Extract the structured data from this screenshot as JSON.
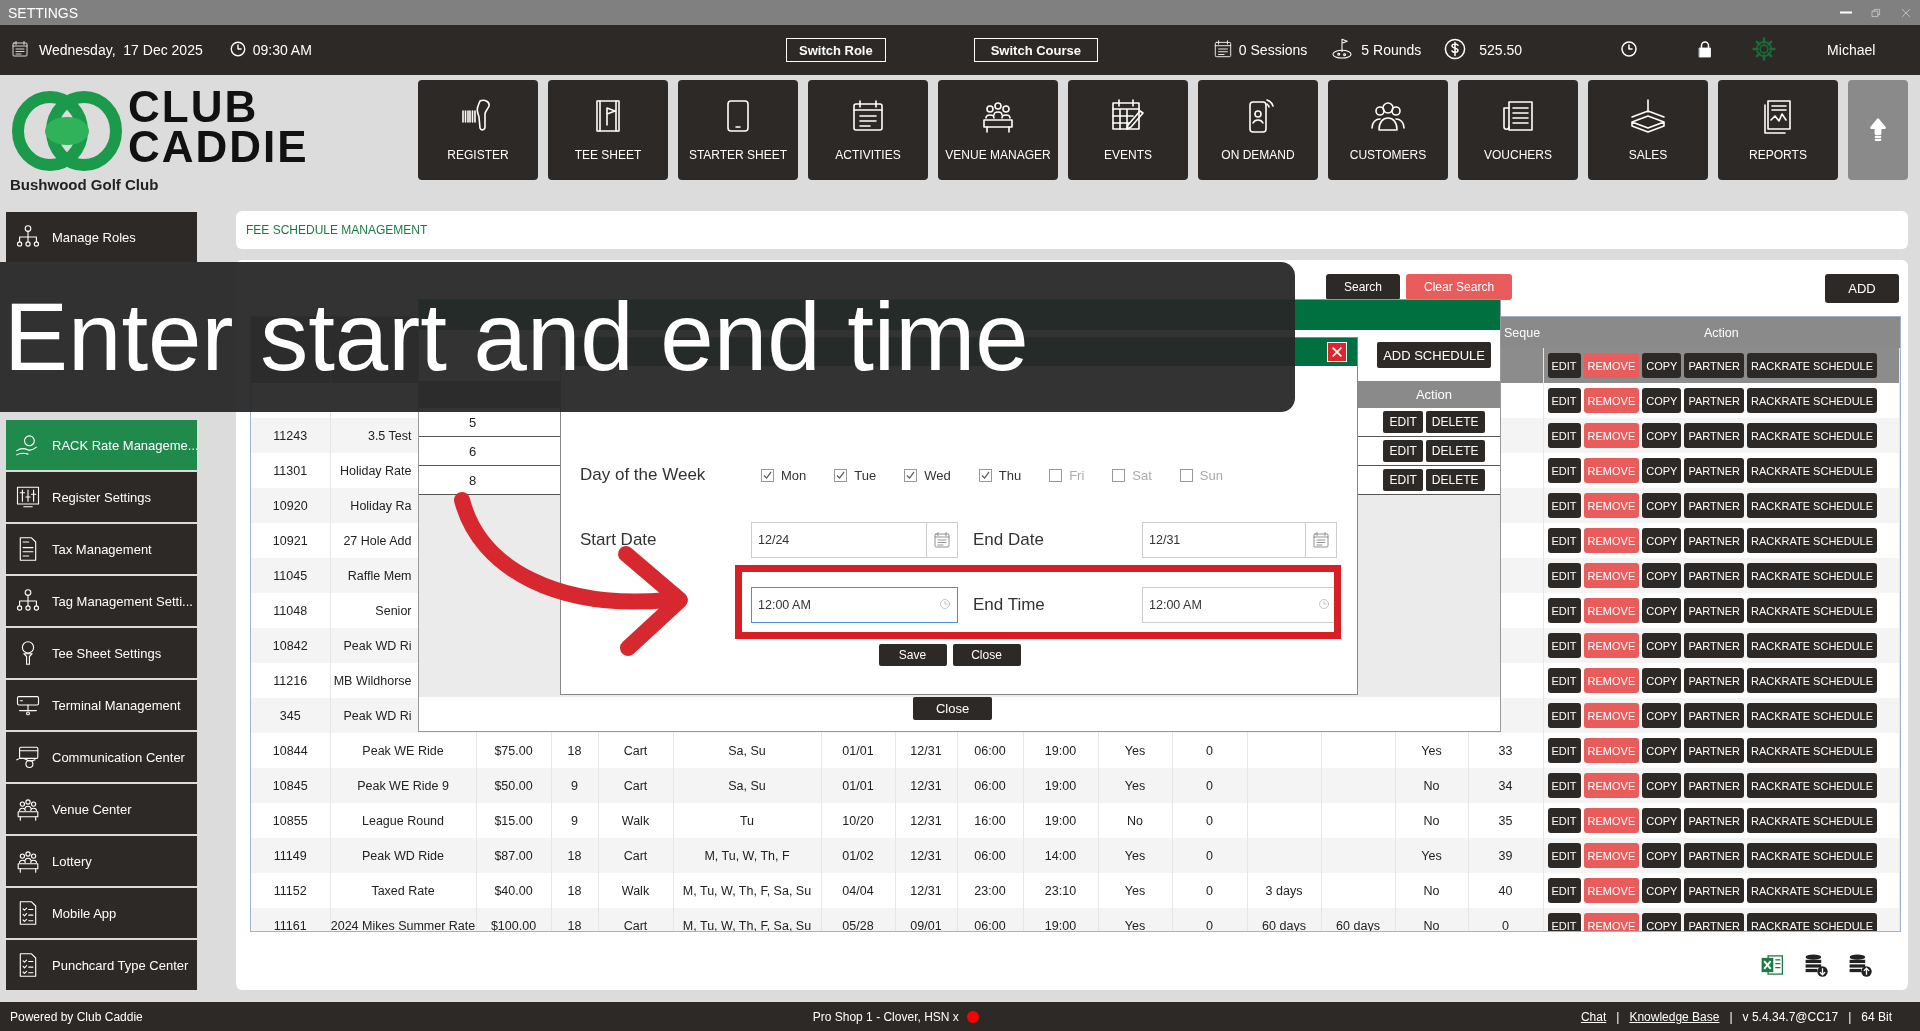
{
  "window": {
    "title": "SETTINGS"
  },
  "top_bar": {
    "date": "Wednesday,  17 Dec 2025",
    "time": "09:30 AM",
    "buttons": [
      "Switch Role",
      "Switch Course"
    ],
    "stats": [
      "0 Sessions",
      "5 Rounds",
      "525.50"
    ],
    "user": "Michael"
  },
  "brand": {
    "logo": [
      "CLUB",
      "CADDIE"
    ],
    "club": "Bushwood Golf Club"
  },
  "nav": [
    "REGISTER",
    "TEE SHEET",
    "STARTER SHEET",
    "ACTIVITIES",
    "VENUE MANAGER",
    "EVENTS",
    "ON DEMAND",
    "CUSTOMERS",
    "VOUCHERS",
    "SALES",
    "REPORTS"
  ],
  "sidebar": {
    "top_items": [
      {
        "label": "Manage Roles",
        "selected": false
      }
    ],
    "items": [
      {
        "label": "RACK Rate Manageme...",
        "selected": true
      },
      {
        "label": "Register Settings",
        "selected": false
      },
      {
        "label": "Tax Management",
        "selected": false
      },
      {
        "label": "Tag Management Setti...",
        "selected": false
      },
      {
        "label": "Tee Sheet Settings",
        "selected": false
      },
      {
        "label": "Terminal Management",
        "selected": false
      },
      {
        "label": "Communication Center",
        "selected": false
      },
      {
        "label": "Venue Center",
        "selected": false
      },
      {
        "label": "Lottery",
        "selected": false
      },
      {
        "label": "Mobile App",
        "selected": false
      },
      {
        "label": "Punchcard Type Center",
        "selected": false
      }
    ]
  },
  "page": {
    "title": "FEE SCHEDULE MANAGEMENT",
    "filter_buttons": [
      "Search",
      "Clear Search"
    ],
    "add_button": "ADD"
  },
  "table": {
    "header": {
      "column_16": "Seque",
      "action": "Action"
    },
    "rows": [
      {
        "selected": true,
        "actions": [
          "EDIT",
          "REMOVE",
          "COPY",
          "PARTNER",
          "RACKRATE SCHEDULE"
        ]
      },
      {
        "selected": false,
        "actions": [
          "EDIT",
          "REMOVE",
          "COPY",
          "PARTNER",
          "RACKRATE SCHEDULE"
        ]
      },
      {
        "selected": false,
        "cells": [
          "11243",
          "3.5 Test"
        ],
        "actions": [
          "EDIT",
          "REMOVE",
          "COPY",
          "PARTNER",
          "RACKRATE SCHEDULE"
        ]
      },
      {
        "selected": false,
        "cells": [
          "11301",
          "Holiday Rate"
        ],
        "actions": [
          "EDIT",
          "REMOVE",
          "COPY",
          "PARTNER",
          "RACKRATE SCHEDULE"
        ]
      },
      {
        "selected": false,
        "cells": [
          "10920",
          "Holiday Ra"
        ],
        "actions": [
          "EDIT",
          "REMOVE",
          "COPY",
          "PARTNER",
          "RACKRATE SCHEDULE"
        ]
      },
      {
        "selected": false,
        "cells": [
          "10921",
          "27 Hole Add"
        ],
        "actions": [
          "EDIT",
          "REMOVE",
          "COPY",
          "PARTNER",
          "RACKRATE SCHEDULE"
        ]
      },
      {
        "selected": false,
        "cells": [
          "11045",
          "Raffle Mem"
        ],
        "actions": [
          "EDIT",
          "REMOVE",
          "COPY",
          "PARTNER",
          "RACKRATE SCHEDULE"
        ]
      },
      {
        "selected": false,
        "cells": [
          "11048",
          "Senior"
        ],
        "actions": [
          "EDIT",
          "REMOVE",
          "COPY",
          "PARTNER",
          "RACKRATE SCHEDULE"
        ]
      },
      {
        "selected": false,
        "cells": [
          "10842",
          "Peak WD Ri"
        ],
        "actions": [
          "EDIT",
          "REMOVE",
          "COPY",
          "PARTNER",
          "RACKRATE SCHEDULE"
        ]
      },
      {
        "selected": false,
        "cells": [
          "11216",
          "MB Wildhorse"
        ],
        "actions": [
          "EDIT",
          "REMOVE",
          "COPY",
          "PARTNER",
          "RACKRATE SCHEDULE"
        ]
      },
      {
        "selected": false,
        "cells": [
          "345",
          "Peak WD Ri"
        ],
        "actions": [
          "EDIT",
          "REMOVE",
          "COPY",
          "PARTNER",
          "RACKRATE SCHEDULE"
        ]
      },
      {
        "selected": false,
        "cells": [
          "10844",
          "Peak WE Ride",
          "$75.00",
          "18",
          "Cart",
          "Sa, Su",
          "01/01",
          "12/31",
          "06:00",
          "19:00",
          "Yes",
          "0",
          null,
          null,
          "Yes",
          "33"
        ],
        "actions": [
          "EDIT",
          "REMOVE",
          "COPY",
          "PARTNER",
          "RACKRATE SCHEDULE"
        ]
      },
      {
        "selected": false,
        "cells": [
          "10845",
          "Peak WE Ride 9",
          "$50.00",
          "9",
          "Cart",
          "Sa, Su",
          "01/01",
          "12/31",
          "06:00",
          "19:00",
          "Yes",
          "0",
          null,
          null,
          "No",
          "34"
        ],
        "actions": [
          "EDIT",
          "REMOVE",
          "COPY",
          "PARTNER",
          "RACKRATE SCHEDULE"
        ]
      },
      {
        "selected": false,
        "cells": [
          "10855",
          "League Round",
          "$15.00",
          "9",
          "Walk",
          "Tu",
          "10/20",
          "12/31",
          "16:00",
          "19:00",
          "No",
          "0",
          null,
          null,
          "No",
          "35"
        ],
        "actions": [
          "EDIT",
          "REMOVE",
          "COPY",
          "PARTNER",
          "RACKRATE SCHEDULE"
        ]
      },
      {
        "selected": false,
        "cells": [
          "11149",
          "Peak WD Ride",
          "$87.00",
          "18",
          "Cart",
          "M, Tu, W, Th, F",
          "01/02",
          "12/31",
          "06:00",
          "14:00",
          "Yes",
          "0",
          null,
          null,
          "Yes",
          "39"
        ],
        "actions": [
          "EDIT",
          "REMOVE",
          "COPY",
          "PARTNER",
          "RACKRATE SCHEDULE"
        ]
      },
      {
        "selected": false,
        "cells": [
          "11152",
          "Taxed Rate",
          "$40.00",
          "18",
          "Walk",
          "M, Tu, W, Th, F, Sa, Su",
          "04/04",
          "12/31",
          "23:00",
          "23:10",
          "Yes",
          "0",
          "3 days",
          null,
          "No",
          "40"
        ],
        "actions": [
          "EDIT",
          "REMOVE",
          "COPY",
          "PARTNER",
          "RACKRATE SCHEDULE"
        ]
      },
      {
        "selected": false,
        "cells": [
          "11161",
          "2024 Mikes Summer Rate",
          "$100.00",
          "18",
          "Cart",
          "M, Tu, W, Th, F, Sa, Su",
          "05/28",
          "09/01",
          "06:00",
          "19:00",
          "Yes",
          "0",
          "60 days",
          "60 days",
          "No",
          "0"
        ],
        "actions": [
          "EDIT",
          "REMOVE",
          "COPY",
          "PARTNER",
          "RACKRATE SCHEDULE"
        ]
      }
    ]
  },
  "schedule_dialog": {
    "add_button": "ADD SCHEDULE",
    "action_header": "Action",
    "rows": [
      {
        "id": "5",
        "actions": [
          "EDIT",
          "DELETE"
        ]
      },
      {
        "id": "6",
        "actions": [
          "EDIT",
          "DELETE"
        ]
      },
      {
        "id": "8",
        "actions": [
          "EDIT",
          "DELETE"
        ]
      }
    ],
    "close_button": "Close"
  },
  "add_dialog": {
    "day_label": "Day of the Week",
    "days": [
      {
        "label": "Mon",
        "checked": true
      },
      {
        "label": "Tue",
        "checked": true
      },
      {
        "label": "Wed",
        "checked": true
      },
      {
        "label": "Thu",
        "checked": true
      },
      {
        "label": "Fri",
        "checked": false
      },
      {
        "label": "Sat",
        "checked": false
      },
      {
        "label": "Sun",
        "checked": false
      }
    ],
    "start_date": {
      "label": "Start Date",
      "value": "12/24"
    },
    "end_date": {
      "label": "End Date",
      "value": "12/31"
    },
    "start_time": {
      "value": "12:00 AM",
      "focused": true
    },
    "end_time": {
      "label": "End Time",
      "value": "12:00 AM",
      "focused": false
    },
    "buttons": [
      "Save",
      "Close"
    ]
  },
  "caption": "Enter start and end time",
  "status_bar": {
    "left": "Powered by Club Caddie",
    "center": "Pro Shop 1 - Clover, HSN x",
    "right": [
      {
        "text": "Chat",
        "kind": "link"
      },
      {
        "text": "|",
        "kind": "text"
      },
      {
        "text": "Knowledge Base",
        "kind": "link"
      },
      {
        "text": "|",
        "kind": "text"
      },
      {
        "text": "v 5.4.34.7@CC17",
        "kind": "text"
      },
      {
        "text": "|",
        "kind": "text"
      },
      {
        "text": "64 Bit",
        "kind": "text"
      }
    ]
  }
}
